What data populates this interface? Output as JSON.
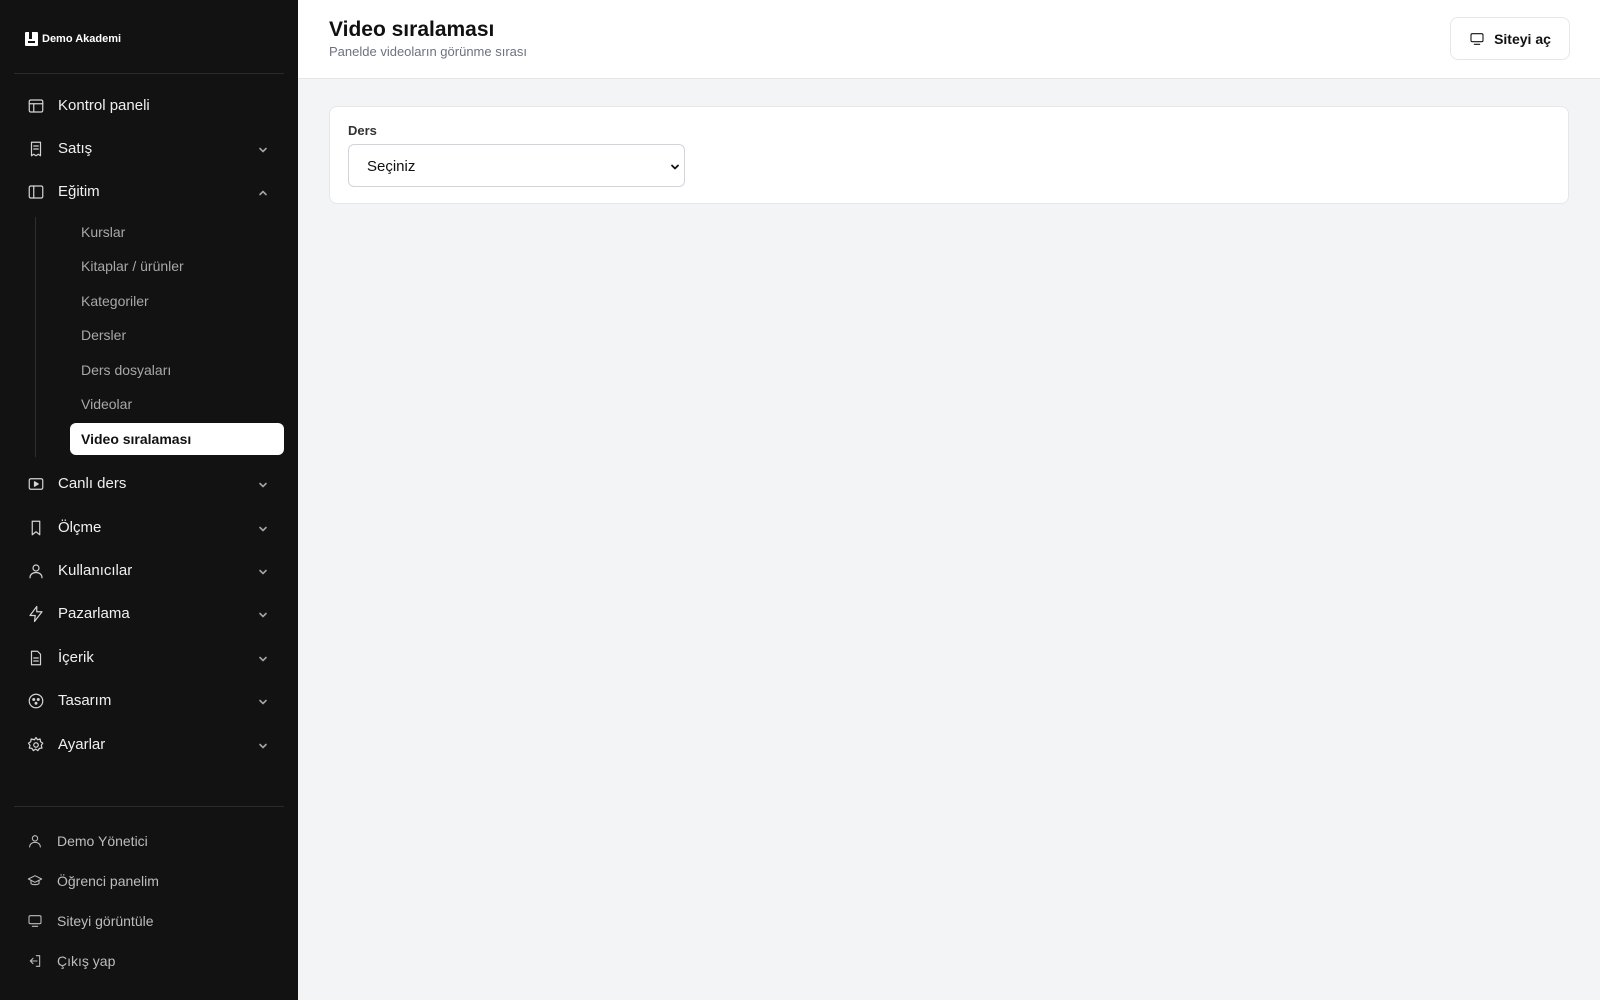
{
  "brand": {
    "name": "Demo Akademi"
  },
  "sidebar": {
    "items": [
      {
        "label": "Kontrol paneli",
        "icon": "layout-icon",
        "chevron": "none"
      },
      {
        "label": "Satış",
        "icon": "receipt-icon",
        "chevron": "down"
      },
      {
        "label": "Eğitim",
        "icon": "panel-icon",
        "chevron": "up"
      },
      {
        "label": "Canlı ders",
        "icon": "video-icon",
        "chevron": "down"
      },
      {
        "label": "Ölçme",
        "icon": "bookmark-icon",
        "chevron": "down"
      },
      {
        "label": "Kullanıcılar",
        "icon": "user-icon",
        "chevron": "down"
      },
      {
        "label": "Pazarlama",
        "icon": "bolt-icon",
        "chevron": "down"
      },
      {
        "label": "İçerik",
        "icon": "file-icon",
        "chevron": "down"
      },
      {
        "label": "Tasarım",
        "icon": "palette-icon",
        "chevron": "down"
      },
      {
        "label": "Ayarlar",
        "icon": "gear-icon",
        "chevron": "down"
      }
    ],
    "education_sub": [
      {
        "label": "Kurslar"
      },
      {
        "label": "Kitaplar / ürünler"
      },
      {
        "label": "Kategoriler"
      },
      {
        "label": "Dersler"
      },
      {
        "label": "Ders dosyaları"
      },
      {
        "label": "Videolar"
      },
      {
        "label": "Video sıralaması",
        "active": true
      }
    ],
    "footer": [
      {
        "label": "Demo Yönetici",
        "icon": "user-icon"
      },
      {
        "label": "Öğrenci panelim",
        "icon": "graduation-cap-icon"
      },
      {
        "label": "Siteyi görüntüle",
        "icon": "monitor-icon"
      },
      {
        "label": "Çıkış yap",
        "icon": "logout-icon"
      }
    ]
  },
  "header": {
    "title": "Video sıralaması",
    "subtitle": "Panelde videoların görünme sırası",
    "site_button_label": "Siteyi aç",
    "site_button_icon": "monitor-icon"
  },
  "form": {
    "course_label": "Ders",
    "course_select_value": "Seçiniz"
  },
  "colors": {
    "sidebar_bg": "#121212",
    "page_bg": "#f3f4f6",
    "active_item_bg": "#ffffff"
  }
}
